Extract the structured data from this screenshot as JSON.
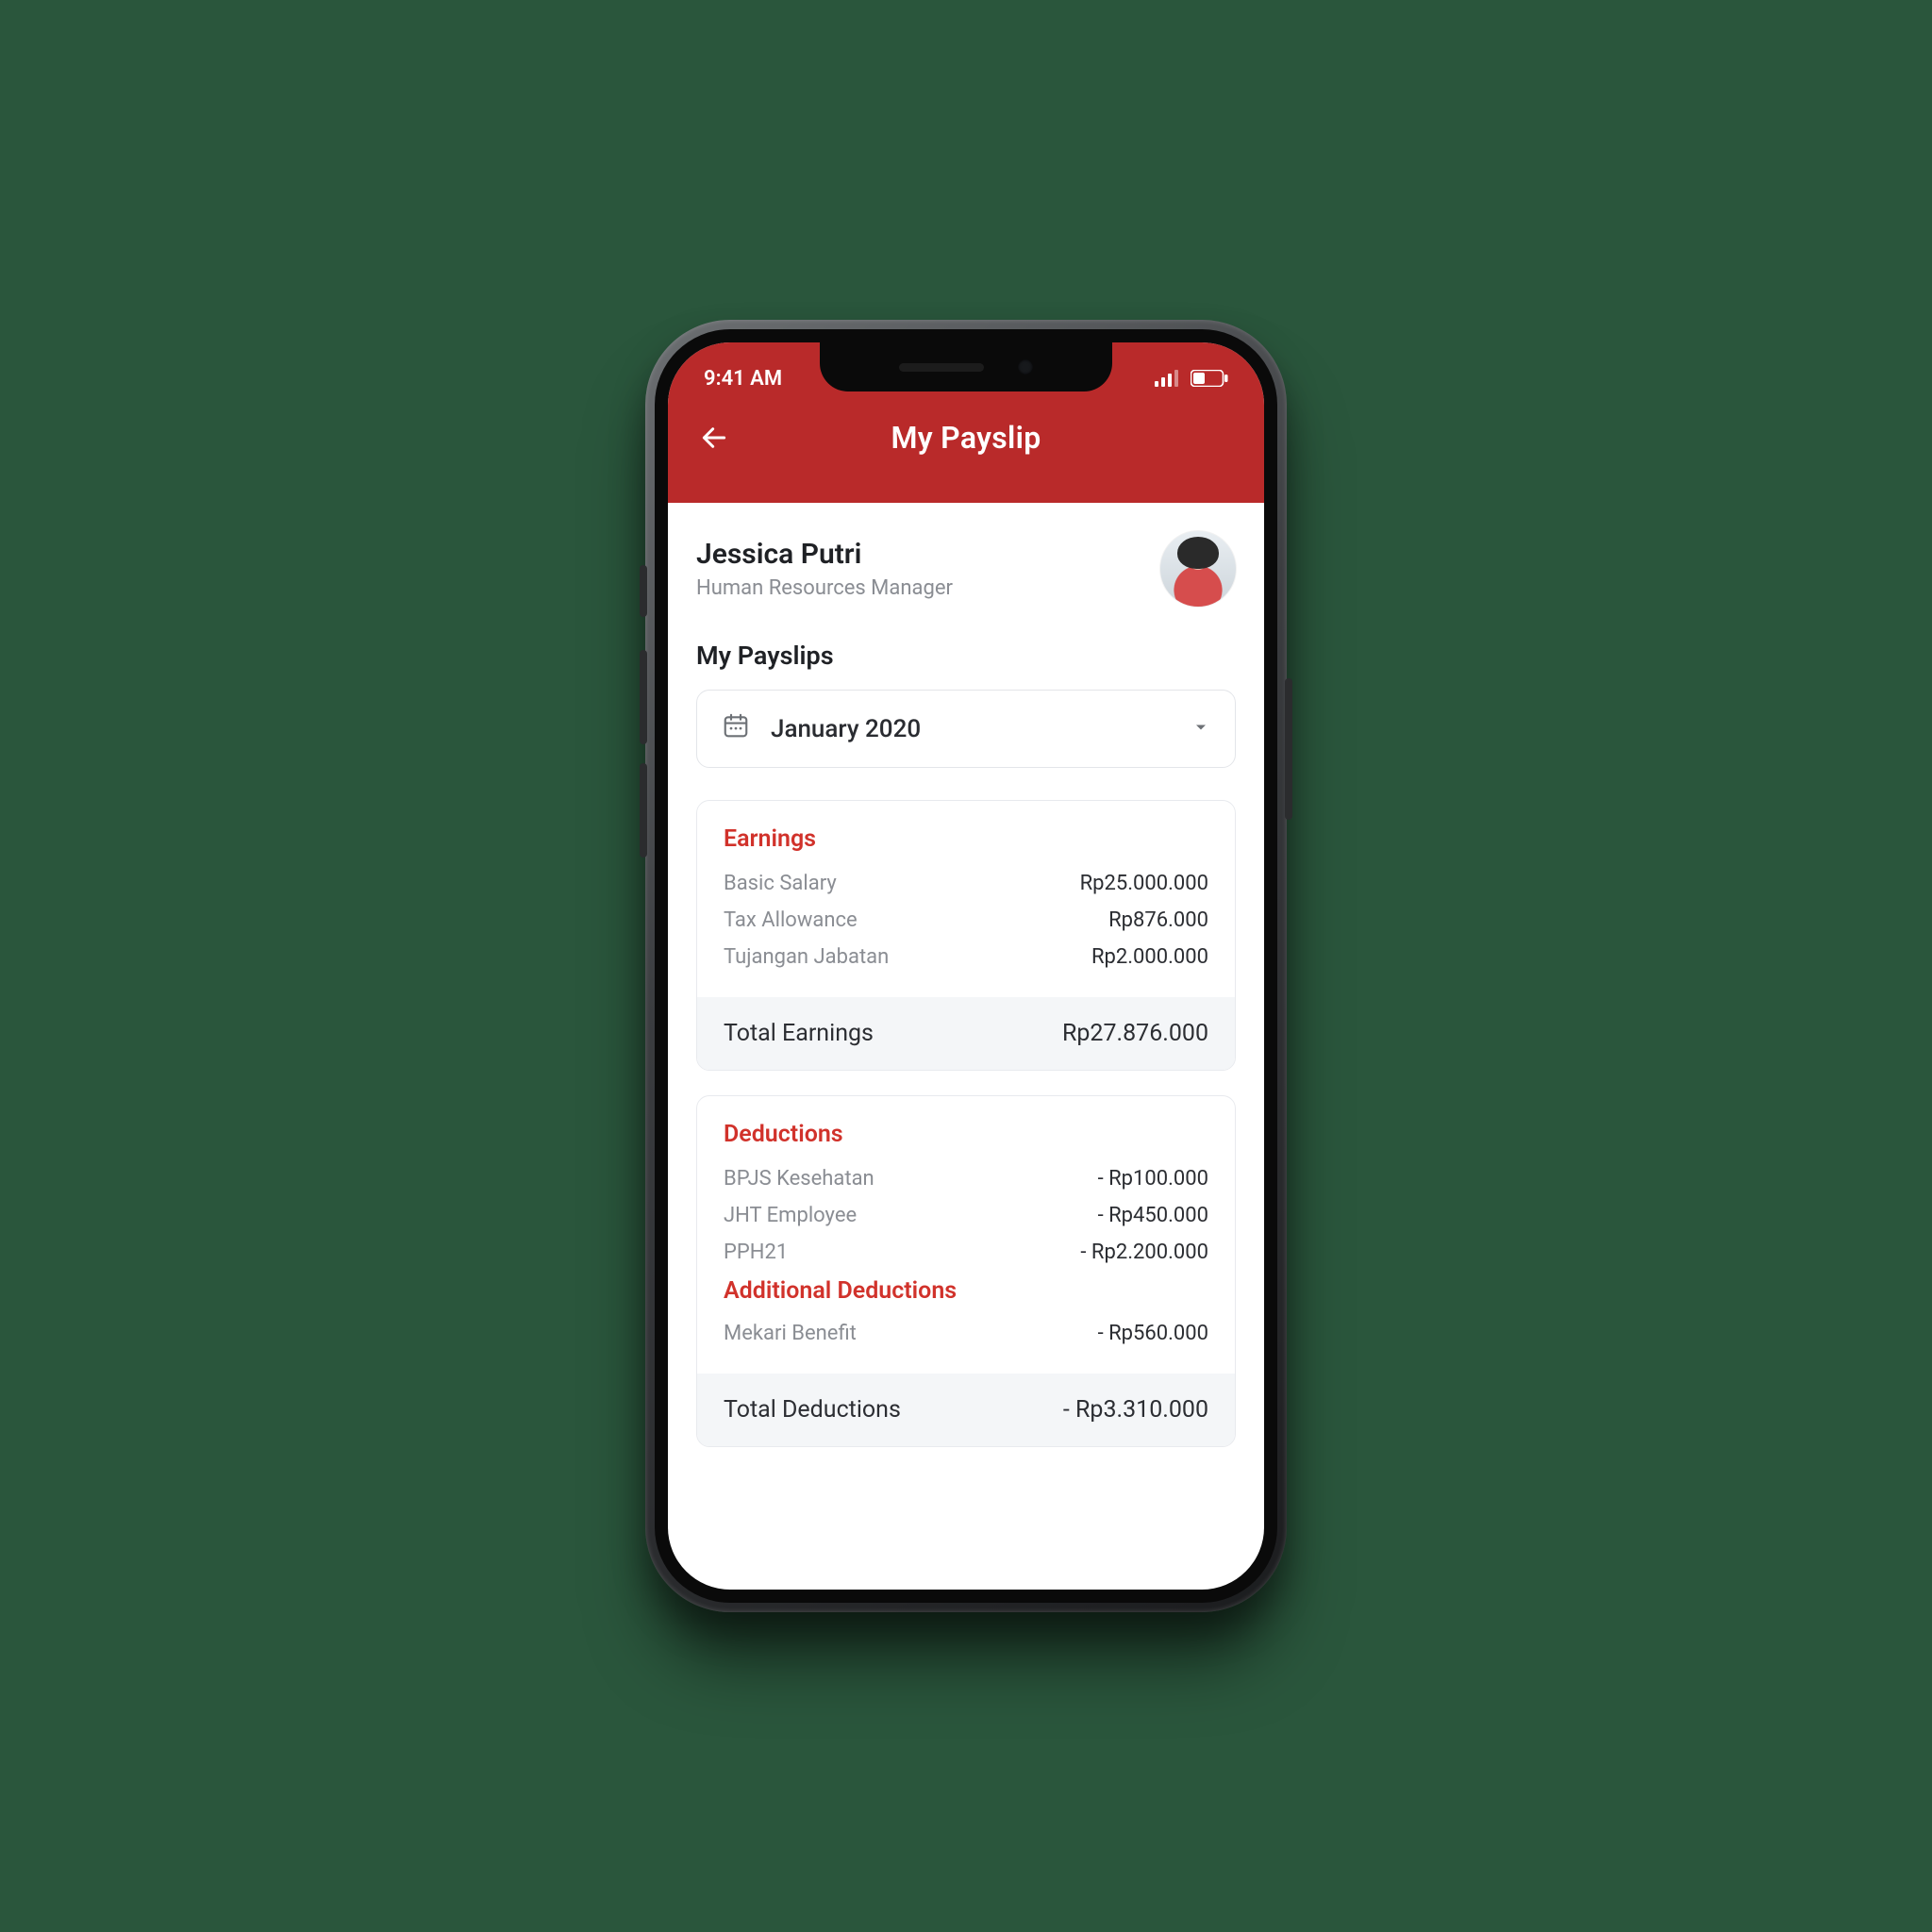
{
  "status": {
    "time": "9:41 AM"
  },
  "header": {
    "title": "My Payslip"
  },
  "profile": {
    "name": "Jessica Putri",
    "role": "Human Resources Manager"
  },
  "section": {
    "title": "My Payslips"
  },
  "period": {
    "selected": "January 2020"
  },
  "earnings": {
    "heading": "Earnings",
    "items": [
      {
        "label": "Basic Salary",
        "value": "Rp25.000.000"
      },
      {
        "label": "Tax Allowance",
        "value": "Rp876.000"
      },
      {
        "label": "Tujangan Jabatan",
        "value": "Rp2.000.000"
      }
    ],
    "total_label": "Total Earnings",
    "total_value": "Rp27.876.000"
  },
  "deductions": {
    "heading": "Deductions",
    "items": [
      {
        "label": "BPJS Kesehatan",
        "value": "- Rp100.000"
      },
      {
        "label": "JHT Employee",
        "value": "- Rp450.000"
      },
      {
        "label": "PPH21",
        "value": "- Rp2.200.000"
      }
    ],
    "additional_heading": "Additional Deductions",
    "additional_items": [
      {
        "label": "Mekari Benefit",
        "value": "- Rp560.000"
      }
    ],
    "total_label": "Total Deductions",
    "total_value": "- Rp3.310.000"
  }
}
